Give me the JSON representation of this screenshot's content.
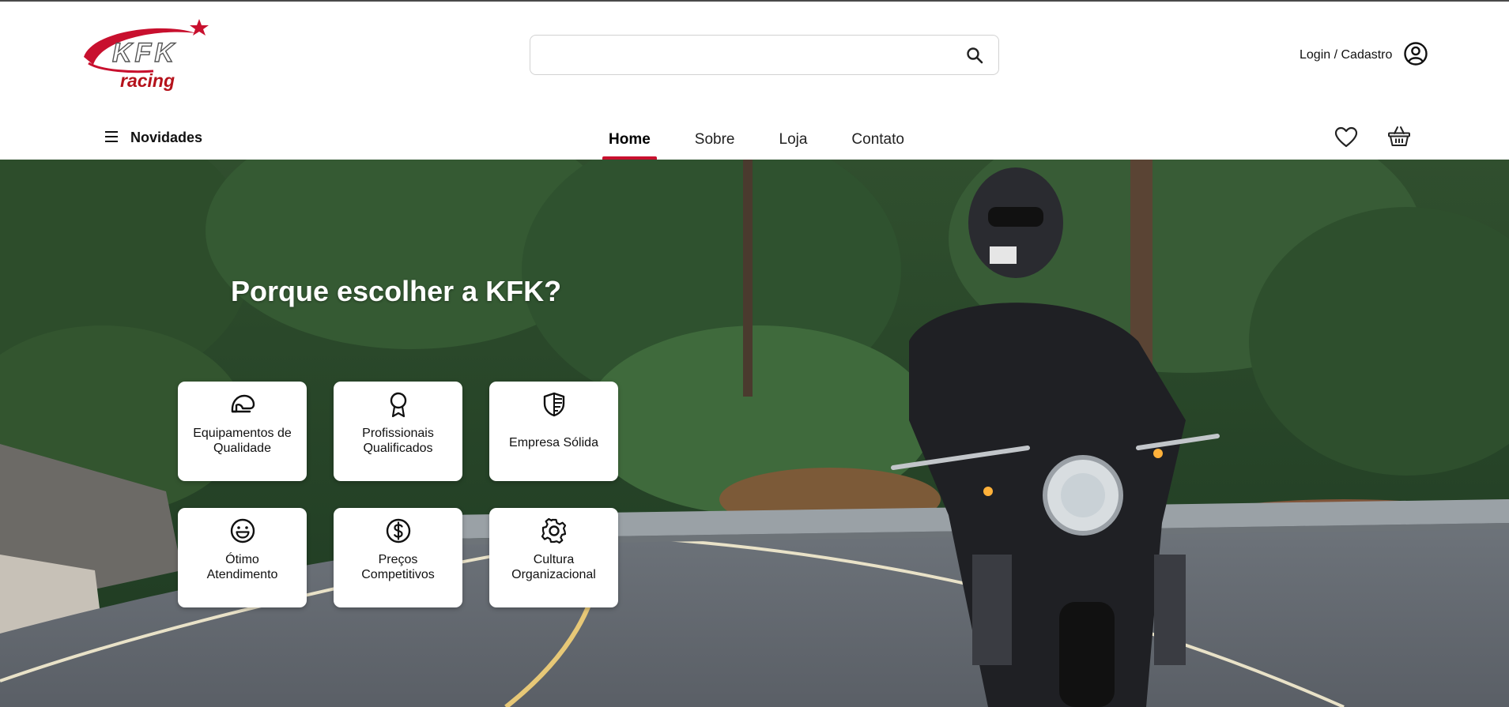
{
  "header": {
    "logo_text": "KFK",
    "logo_sub": "racing",
    "search": {
      "placeholder": "",
      "value": ""
    },
    "login_label": "Login / Cadastro"
  },
  "nav": {
    "menu_label": "Novidades",
    "links": [
      {
        "label": "Home",
        "active": true
      },
      {
        "label": "Sobre",
        "active": false
      },
      {
        "label": "Loja",
        "active": false
      },
      {
        "label": "Contato",
        "active": false
      }
    ]
  },
  "hero": {
    "title": "Porque escolher a KFK?",
    "features": [
      {
        "line1": "Equipamentos de",
        "line2": "Qualidade",
        "icon": "helmet-icon"
      },
      {
        "line1": "Profissionais",
        "line2": "Qualificados",
        "icon": "award-icon"
      },
      {
        "line1": "Empresa Sólida",
        "line2": "",
        "icon": "shield-icon"
      },
      {
        "line1": "Ótimo",
        "line2": "Atendimento",
        "icon": "smile-icon"
      },
      {
        "line1": "Preços",
        "line2": "Competitivos",
        "icon": "dollar-icon"
      },
      {
        "line1": "Cultura",
        "line2": "Organizacional",
        "icon": "gear-icon"
      }
    ]
  },
  "colors": {
    "accent": "#c8102e",
    "text": "#111111"
  }
}
